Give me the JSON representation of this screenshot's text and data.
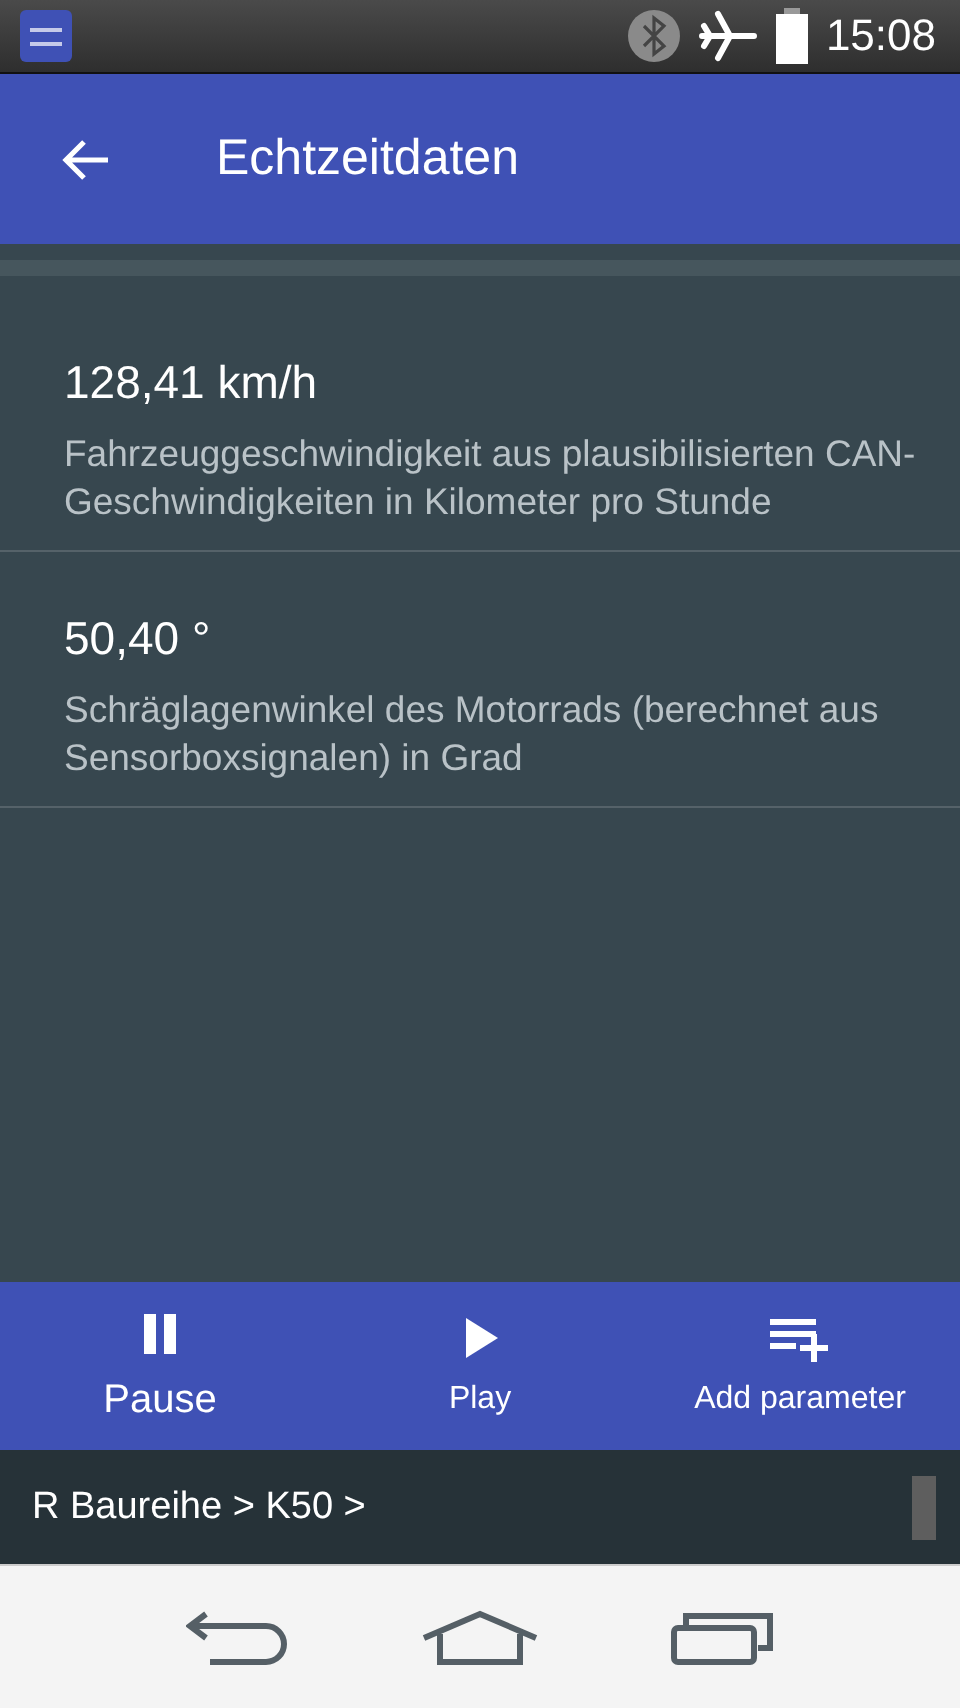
{
  "status_bar": {
    "time": "15:08"
  },
  "toolbar": {
    "title": "Echtzeitdaten"
  },
  "parameters": [
    {
      "value": "128,41 km/h",
      "description": "Fahrzeuggeschwindigkeit aus plausibilisierten CAN-Geschwindigkeiten in Kilometer pro Stunde"
    },
    {
      "value": "50,40 °",
      "description": "Schräglagenwinkel des Motorrads (berechnet aus Sensorboxsignalen) in Grad"
    }
  ],
  "actions": [
    {
      "kind": "pause",
      "label": "Pause"
    },
    {
      "kind": "play",
      "label": "Play"
    },
    {
      "kind": "add",
      "label": "Add parameter"
    }
  ],
  "breadcrumb": "R Baureihe > K50 >"
}
